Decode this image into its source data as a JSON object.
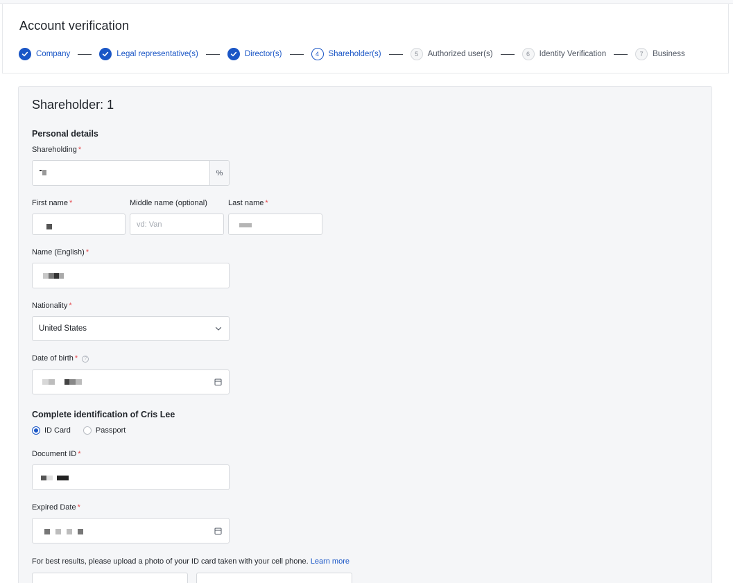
{
  "header": {
    "title": "Account verification",
    "steps": [
      {
        "number": "1",
        "label": "Company",
        "status": "done"
      },
      {
        "number": "2",
        "label": "Legal representative(s)",
        "status": "done"
      },
      {
        "number": "3",
        "label": "Director(s)",
        "status": "done"
      },
      {
        "number": "4",
        "label": "Shareholder(s)",
        "status": "active"
      },
      {
        "number": "5",
        "label": "Authorized user(s)",
        "status": "todo"
      },
      {
        "number": "6",
        "label": "Identity Verification",
        "status": "todo"
      },
      {
        "number": "7",
        "label": "Business",
        "status": "todo"
      }
    ]
  },
  "form": {
    "title": "Shareholder: 1",
    "personal_details_heading": "Personal details",
    "shareholding": {
      "label": "Shareholding",
      "required": "*",
      "suffix": "%"
    },
    "first_name": {
      "label": "First name",
      "required": "*"
    },
    "middle_name": {
      "label": "Middle name (optional)",
      "placeholder": "vd: Van"
    },
    "last_name": {
      "label": "Last name",
      "required": "*"
    },
    "name_english": {
      "label": "Name (English)",
      "required": "*"
    },
    "nationality": {
      "label": "Nationality",
      "required": "*",
      "value": "United States"
    },
    "dob": {
      "label": "Date of birth",
      "required": "*",
      "help": "?"
    },
    "identification_heading": "Complete identification of Cris Lee",
    "id_type": {
      "options": [
        "ID Card",
        "Passport"
      ],
      "selected": "ID Card"
    },
    "document_id": {
      "label": "Document ID",
      "required": "*"
    },
    "expired_date": {
      "label": "Expired Date",
      "required": "*"
    },
    "upload_hint": "For best results, please upload a photo of your ID card taken with your cell phone.",
    "learn_more": "Learn more"
  },
  "colors": {
    "accent": "#1a56c6",
    "required": "#e5484d",
    "panel_bg": "#f5f6f8"
  },
  "icons": {
    "step_done": "check-icon",
    "select": "chevron-down-icon",
    "date": "calendar-icon",
    "help": "help-circle-icon"
  }
}
